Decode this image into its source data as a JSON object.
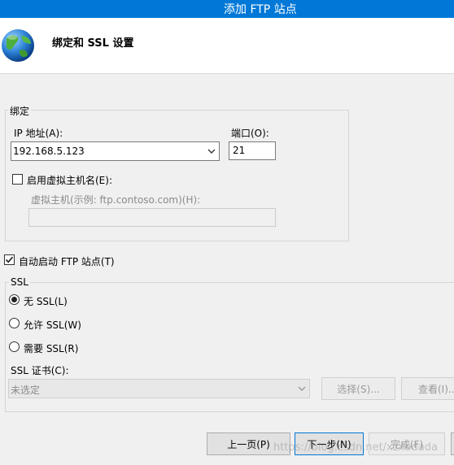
{
  "window": {
    "title": "添加 FTP 站点"
  },
  "header": {
    "title": "绑定和 SSL 设置",
    "icon": "globe-icon"
  },
  "binding": {
    "legend": "绑定",
    "ip_label": "IP 地址(A):",
    "ip_value": "192.168.5.123",
    "port_label": "端口(O):",
    "port_value": "21",
    "virtual_host_checkbox_label": "启用虚拟主机名(E):",
    "virtual_host_checked": false,
    "virtual_host_field_label": "虚拟主机(示例: ftp.contoso.com)(H):",
    "virtual_host_value": ""
  },
  "auto_start": {
    "label": "自动启动 FTP 站点(T)",
    "checked": true
  },
  "ssl": {
    "legend": "SSL",
    "options": [
      {
        "label": "无 SSL(L)",
        "selected": true
      },
      {
        "label": "允许 SSL(W)",
        "selected": false
      },
      {
        "label": "需要 SSL(R)",
        "selected": false
      }
    ],
    "cert_label": "SSL 证书(C):",
    "cert_value": "未选定",
    "select_button": "选择(S)...",
    "view_button": "查看(I)..."
  },
  "footer": {
    "prev_button": "上一页(P)",
    "next_button": "下一步(N)",
    "finish_button": "完成(F)"
  },
  "watermark": "https://blog.csdn.net/xzxbdada",
  "colors": {
    "titlebar": "#0078d7",
    "focus_border": "#0078d7"
  }
}
